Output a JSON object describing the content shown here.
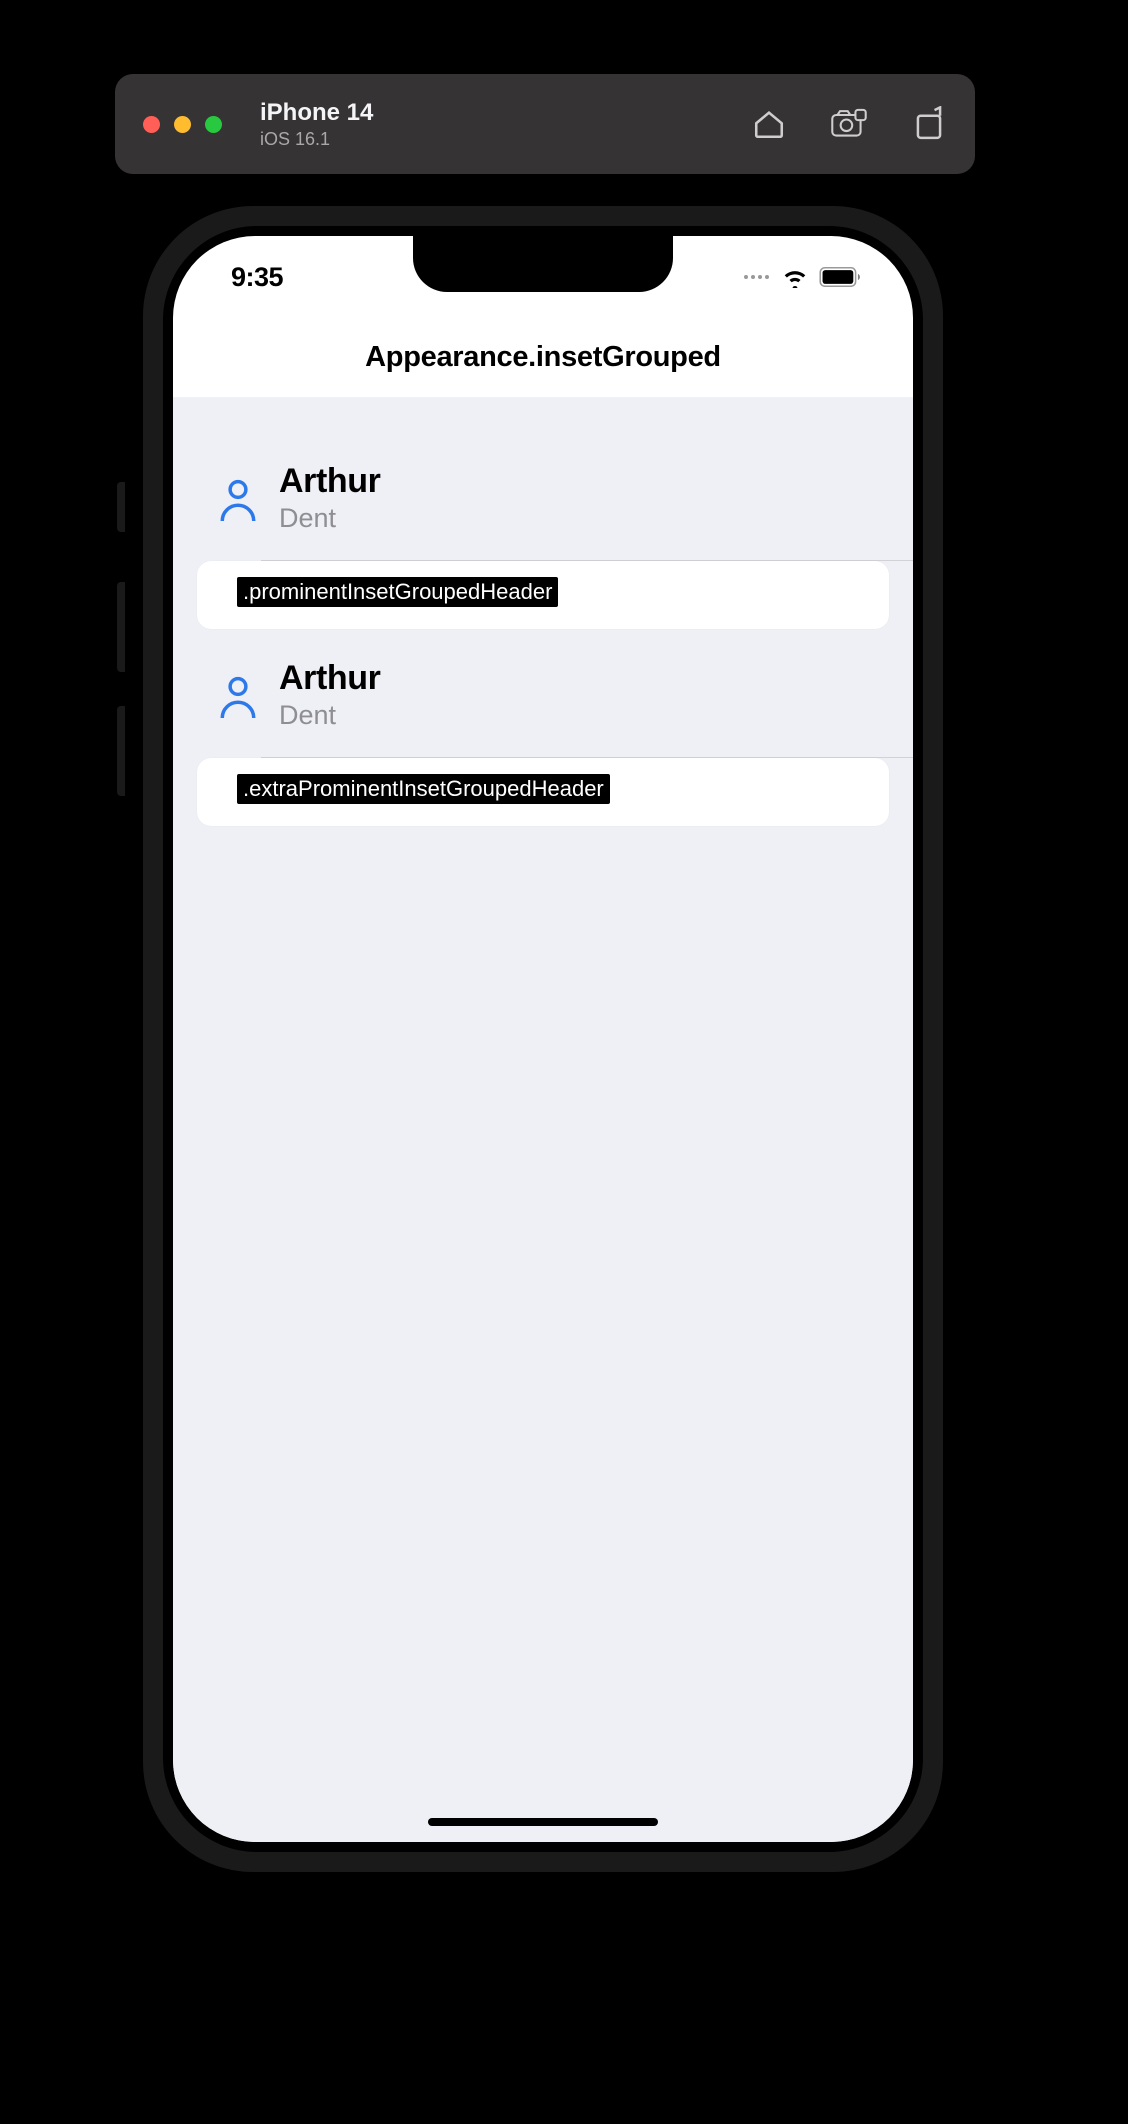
{
  "simulator": {
    "device_name": "iPhone 14",
    "os_version": "iOS 16.1"
  },
  "status_bar": {
    "time": "9:35"
  },
  "nav": {
    "title": "Appearance.insetGrouped"
  },
  "sections": [
    {
      "header_title": "Arthur",
      "header_subtitle": "Dent",
      "annotation": ".prominentInsetGroupedHeader",
      "icon": "person"
    },
    {
      "header_title": "Arthur",
      "header_subtitle": "Dent",
      "annotation": ".extraProminentInsetGroupedHeader",
      "icon": "person"
    }
  ]
}
